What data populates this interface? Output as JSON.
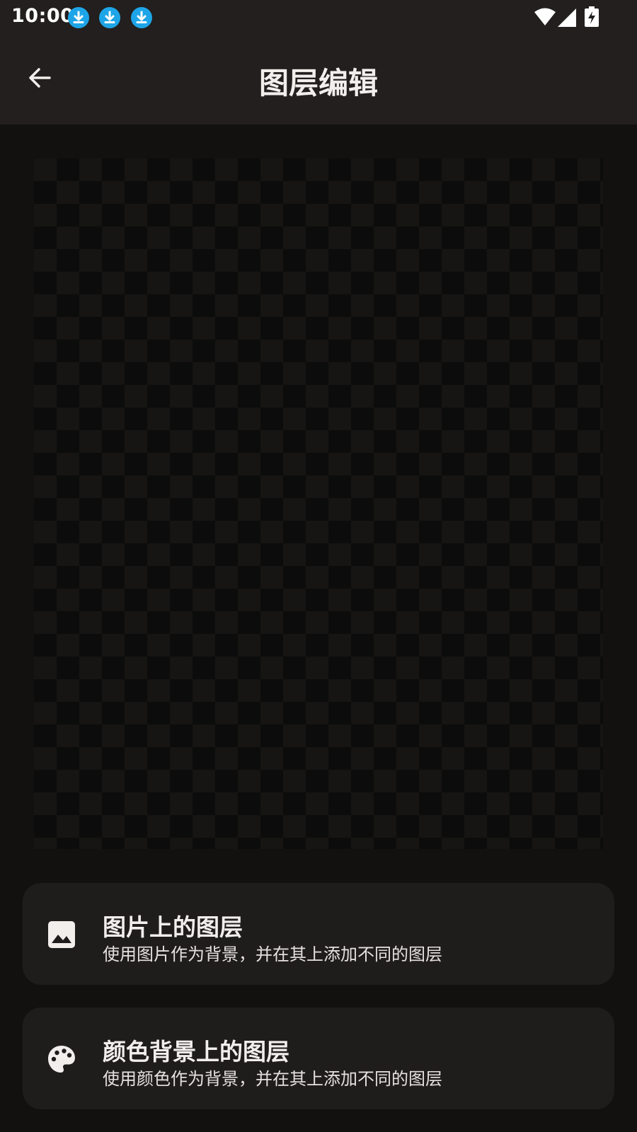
{
  "status_bar": {
    "time": "10:00",
    "icons": [
      "download-icon",
      "download-icon",
      "download-icon",
      "wifi-icon",
      "signal-icon",
      "battery-charging-icon"
    ]
  },
  "app_bar": {
    "back_icon": "arrow-back-icon",
    "title": "图层编辑"
  },
  "canvas": {
    "pattern": "transparency-checkerboard",
    "colors": {
      "light": "#161513",
      "dark": "#0c0c0c"
    }
  },
  "options": [
    {
      "icon": "image-icon",
      "title": "图片上的图层",
      "subtitle": "使用图片作为背景，并在其上添加不同的图层"
    },
    {
      "icon": "palette-icon",
      "title": "颜色背景上的图层",
      "subtitle": "使用颜色作为背景，并在其上添加不同的图层"
    }
  ],
  "colors": {
    "background": "#121110",
    "bar": "#221f1e",
    "card": "#1f1d1c",
    "download_badge": "#1ea5e8",
    "text": "#f1eeec"
  }
}
